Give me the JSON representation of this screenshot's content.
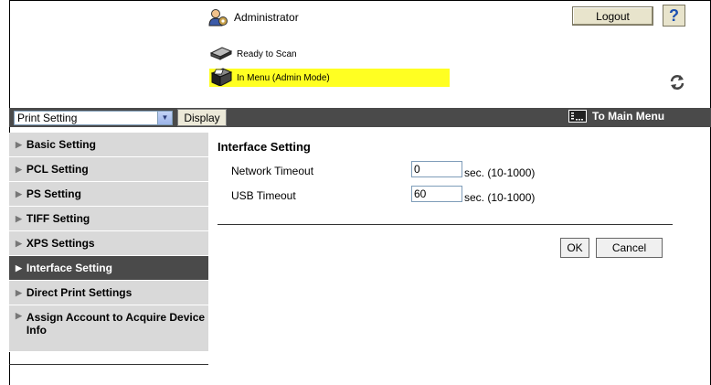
{
  "header": {
    "user_label": "Administrator",
    "logout_label": "Logout",
    "help_label": "?"
  },
  "status": {
    "line1": "Ready to Scan",
    "line2": "In Menu (Admin Mode)",
    "highlight_color": "#ffff22"
  },
  "navbar": {
    "select_value": "Print Setting",
    "display_label": "Display",
    "main_menu_label": "To Main Menu"
  },
  "sidebar": {
    "items": [
      {
        "label": "Basic Setting"
      },
      {
        "label": "PCL Setting"
      },
      {
        "label": "PS Setting"
      },
      {
        "label": "TIFF Setting"
      },
      {
        "label": "XPS Settings"
      },
      {
        "label": "Interface Setting"
      },
      {
        "label": "Direct Print Settings"
      },
      {
        "label": "Assign Account to Acquire Device Info"
      }
    ]
  },
  "main": {
    "title": "Interface Setting",
    "fields": [
      {
        "label": "Network Timeout",
        "value": "0",
        "unit": "sec. (10-1000)"
      },
      {
        "label": "USB Timeout",
        "value": "60",
        "unit": "sec. (10-1000)"
      }
    ],
    "ok_label": "OK",
    "cancel_label": "Cancel"
  },
  "icons": {
    "user": "admin-user-icon",
    "scanner": "scanner-icon",
    "printer": "printer-icon",
    "refresh": "refresh-icon",
    "main_menu": "main-menu-icon",
    "dropdown": "chevron-down-icon"
  }
}
